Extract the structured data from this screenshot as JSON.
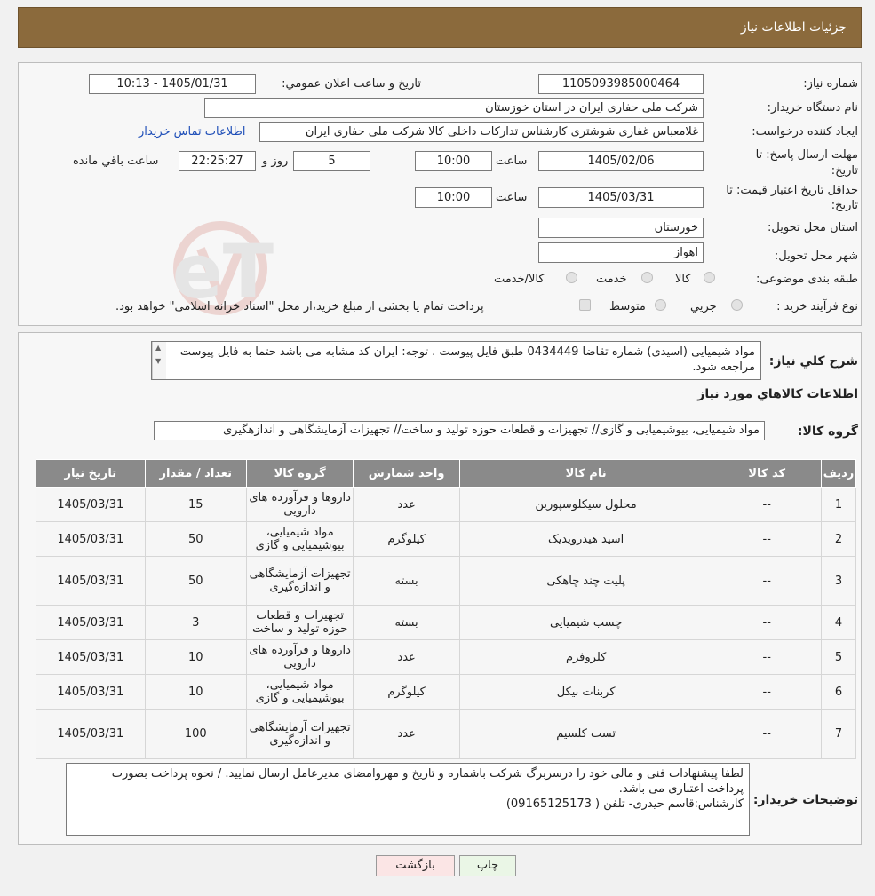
{
  "header": {
    "title": "جزئیات اطلاعات نیاز"
  },
  "watermark": {
    "text": "AriaTender.neT"
  },
  "form": {
    "need_number_label": "شماره نیاز:",
    "need_number": "1105093985000464",
    "announce_label": "تاریخ و ساعت اعلان عمومي:",
    "announce_value": "1405/01/31 - 10:13",
    "buyer_label": "نام دستگاه خريدار:",
    "buyer_value": "شرکت ملی حفاری ایران در استان خوزستان",
    "requester_label": "ايجاد کننده درخواست:",
    "requester_value": "غلامعباس غفاری شوشتری کارشناس تدارکات داخلی کالا شرکت ملی حفاری ایران",
    "contact_link": "اطلاعات تماس خريدار",
    "deadline_label_1": "مهلت ارسال پاسخ: تا",
    "deadline_label_2": "تاريخ:",
    "deadline_date": "1405/02/06",
    "time_label": "ساعت",
    "deadline_time": "10:00",
    "days_value": "5",
    "days_label": "روز و",
    "remaining_value": "22:25:27",
    "remaining_label": "ساعت باقي مانده",
    "validity_label_1": "حداقل تاريخ اعتبار قيمت: تا",
    "validity_label_2": "تاريخ:",
    "validity_date": "1405/03/31",
    "validity_time_label": "ساعت",
    "validity_time": "10:00",
    "province_label": "استان محل تحويل:",
    "province_value": "خوزستان",
    "city_label": "شهر محل تحويل:",
    "city_value": "اهواز",
    "category_label": "طبقه بندی موضوعی:",
    "category_options": [
      "کالا",
      "خدمت",
      "کالا/خدمت"
    ],
    "process_label": "نوع فرآيند خريد :",
    "process_options": [
      "جزیي",
      "متوسط"
    ],
    "process_note": "پرداخت تمام یا بخشی از مبلغ خرید،از محل \"اسناد خزانه اسلامی\" خواهد بود."
  },
  "description": {
    "label": "شرح کلي نياز:",
    "text": "مواد شیمیایی (اسیدی)  شماره تقاضا 0434449 طبق فایل پیوست . توجه: ایران کد مشابه می باشد حتما به فایل پیوست مراجعه شود.",
    "items_title": "اطلاعات کالاهاي مورد نياز",
    "group_label": "گروه کالا:",
    "group_value": "مواد شیمیایی، بیوشیمیایی و  گازی// تجهیزات و قطعات حوزه تولید و ساخت// تجهیزات آزمایشگاهی و اندازهگیری"
  },
  "table": {
    "headers": [
      "رديف",
      "کد کالا",
      "نام کالا",
      "واحد شمارش",
      "گروه کالا",
      "تعداد / مقدار",
      "تاريخ نياز"
    ],
    "rows": [
      {
        "idx": "1",
        "code": "--",
        "name": "محلول سیکلوسپورین",
        "unit": "عدد",
        "group": "داروها و فرآورده های دارویی",
        "qty": "15",
        "date": "1405/03/31"
      },
      {
        "idx": "2",
        "code": "--",
        "name": "اسید هیدرویدیک",
        "unit": "کیلوگرم",
        "group": "مواد شیمیایی، بیوشیمیایی و گازی",
        "qty": "50",
        "date": "1405/03/31"
      },
      {
        "idx": "3",
        "code": "--",
        "name": "پلیت چند چاهکی",
        "unit": "بسته",
        "group": "تجهیزات آزمایشگاهی و اندازه‌گیری",
        "qty": "50",
        "date": "1405/03/31"
      },
      {
        "idx": "4",
        "code": "--",
        "name": "چسب شیمیایی",
        "unit": "بسته",
        "group": "تجهیزات و قطعات حوزه تولید و ساخت",
        "qty": "3",
        "date": "1405/03/31"
      },
      {
        "idx": "5",
        "code": "--",
        "name": "کلروفرم",
        "unit": "عدد",
        "group": "داروها و فرآورده های دارویی",
        "qty": "10",
        "date": "1405/03/31"
      },
      {
        "idx": "6",
        "code": "--",
        "name": "کربنات نیکل",
        "unit": "کیلوگرم",
        "group": "مواد شیمیایی، بیوشیمیایی و گازی",
        "qty": "10",
        "date": "1405/03/31"
      },
      {
        "idx": "7",
        "code": "--",
        "name": "تست کلسیم",
        "unit": "عدد",
        "group": "تجهیزات آزمایشگاهی و اندازه‌گیری",
        "qty": "100",
        "date": "1405/03/31"
      }
    ]
  },
  "buyer_notes": {
    "label": "توضيحات خريدار:",
    "line1": "لطفا پیشنهادات فنی و مالی خود را درسربرگ شرکت باشماره و تاریخ و مهروامضای مدیرعامل ارسال نمایید. / نحوه پرداخت بصورت پرداخت اعتباری می باشد.",
    "line2": "کارشناس:قاسم حیدری- تلفن ( 09165125173)"
  },
  "buttons": {
    "print": "چاپ",
    "back": "بازگشت"
  }
}
